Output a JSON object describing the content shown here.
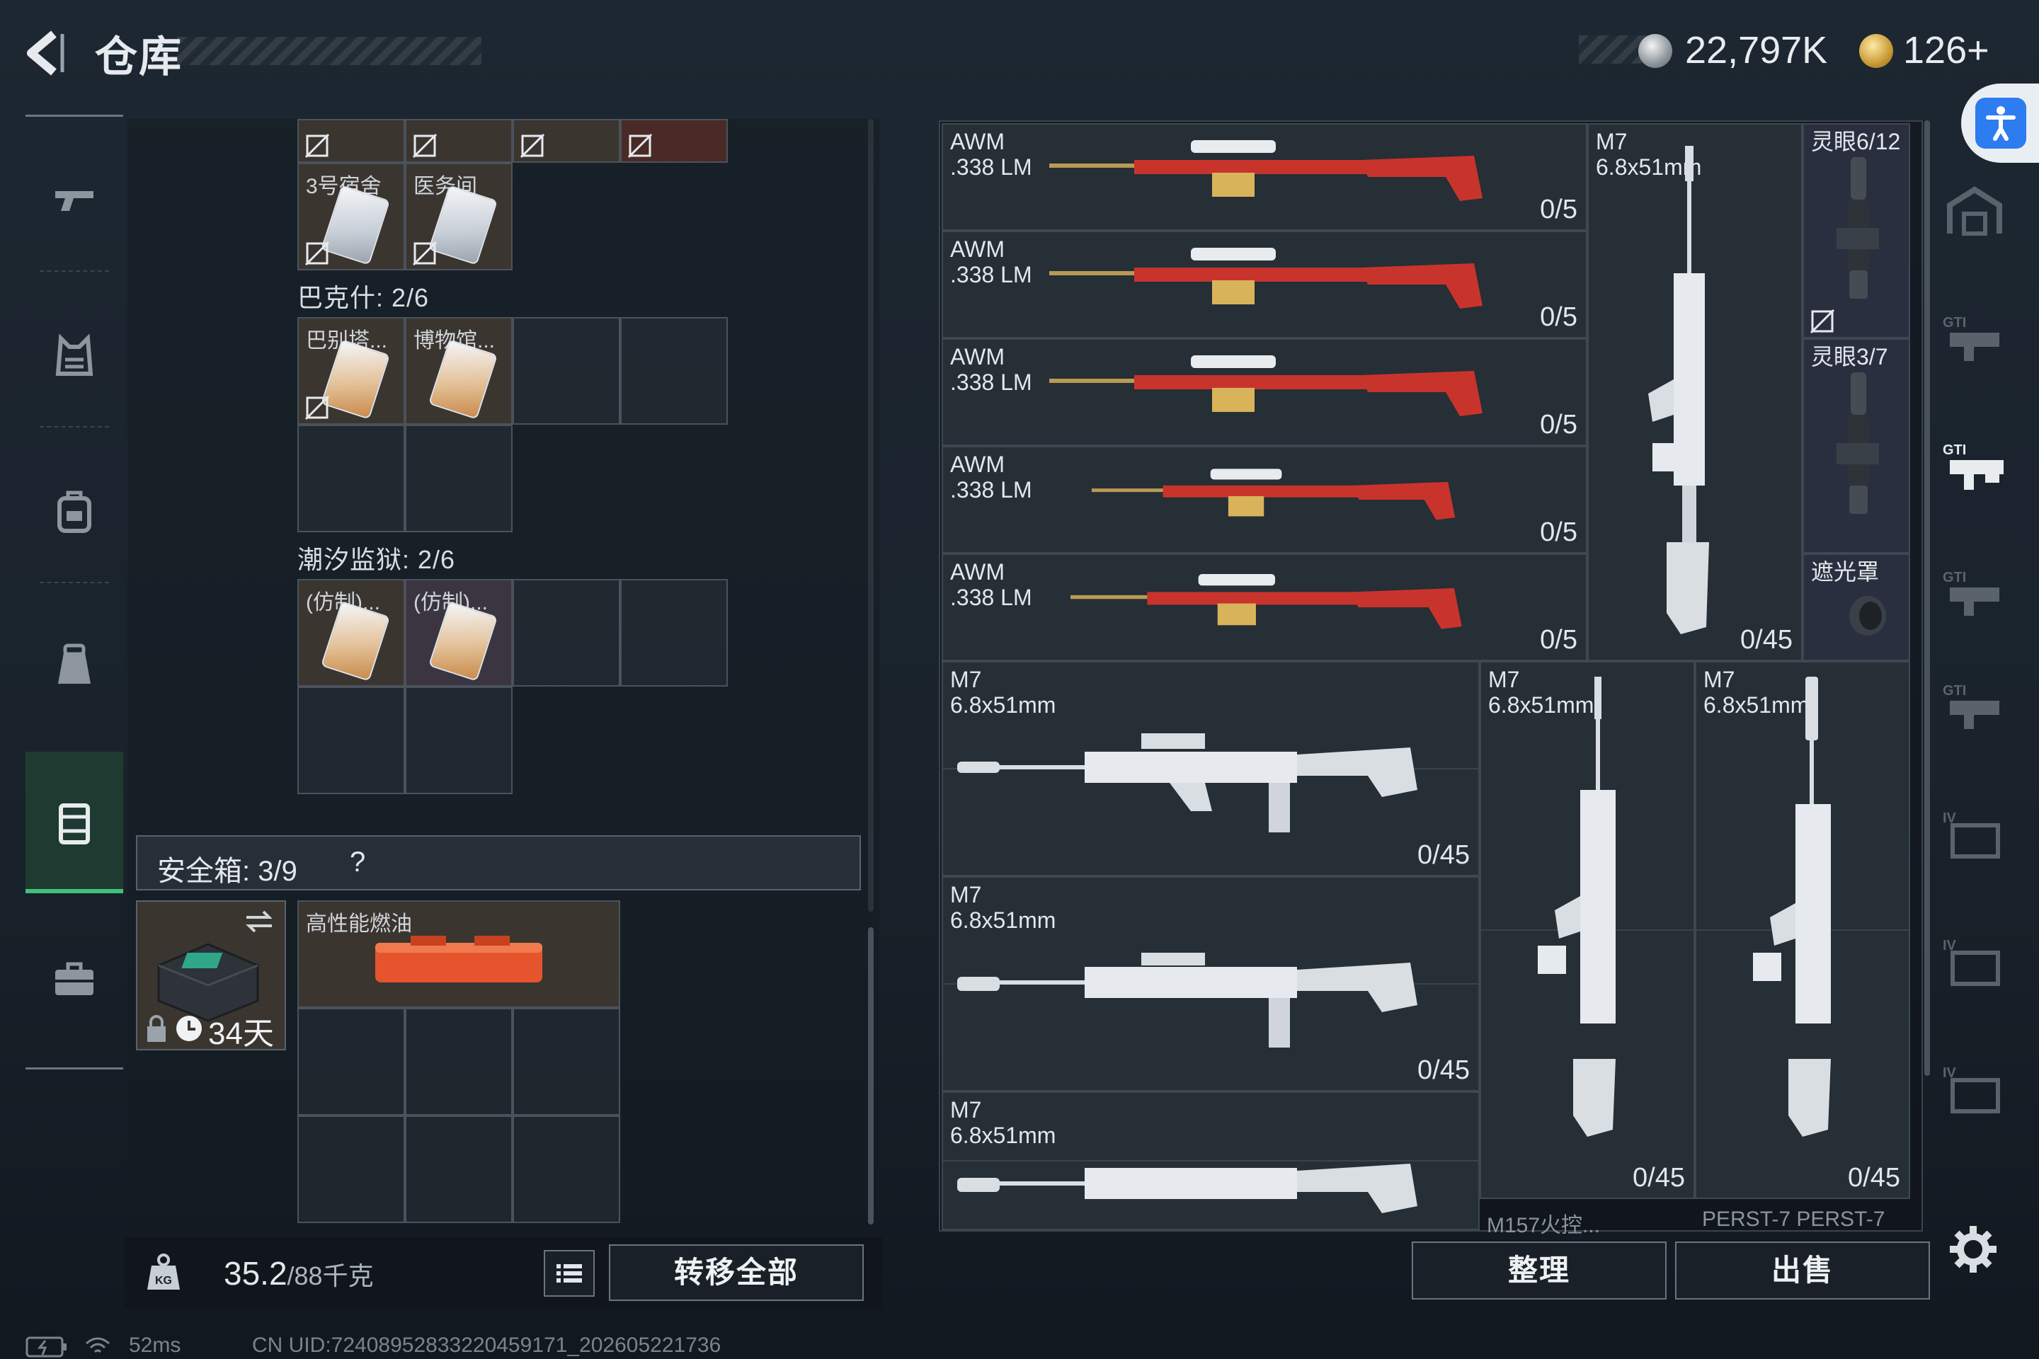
{
  "header": {
    "title": "仓库",
    "currency_silver": "22,797K",
    "currency_gold": "126",
    "gold_plus": "+"
  },
  "storage": {
    "top_row_labels": [
      "3号宿舍",
      "医务间"
    ],
    "section_bakshi": "巴克什: 2/6",
    "bakshi_items": [
      "巴别塔...",
      "博物馆..."
    ],
    "section_tidal": "潮汐监狱: 2/6",
    "tidal_items": [
      "(仿制)...",
      "(仿制)..."
    ],
    "safebox_label": "安全箱: 3/9",
    "safebox_help": "?",
    "safebox_days": "34天",
    "fuel_label": "高性能燃油",
    "weight_current": "35.2",
    "weight_max": "/88千克",
    "transfer_all": "转移全部"
  },
  "weapons": {
    "awm": [
      {
        "name": "AWM\n.338 LM",
        "ammo": "0/5"
      },
      {
        "name": "AWM\n.338 LM",
        "ammo": "0/5"
      },
      {
        "name": "AWM\n.338 LM",
        "ammo": "0/5"
      },
      {
        "name": "AWM\n.338 LM",
        "ammo": "0/5"
      },
      {
        "name": "AWM\n.338 LM",
        "ammo": "0/5"
      }
    ],
    "m7_tall": {
      "name": "M7\n6.8x51mm",
      "ammo": "0/45"
    },
    "attachments": [
      "灵眼6/12",
      "灵眼3/7",
      "遮光罩"
    ],
    "m7_wide": [
      {
        "name": "M7\n6.8x51mm",
        "ammo": "0/45"
      },
      {
        "name": "M7\n6.8x51mm",
        "ammo": "0/45"
      },
      {
        "name": "M7\n6.8x51mm",
        "ammo": ""
      }
    ],
    "m7_vertical": [
      {
        "name": "M7\n6.8x51mm",
        "ammo": "0/45",
        "caption": "M157火控..."
      },
      {
        "name": "M7\n6.8x51mm",
        "ammo": "0/45",
        "caption": "PERST-7 PERST-7"
      }
    ],
    "sort_label": "整理",
    "sell_label": "出售"
  },
  "status_bar": {
    "ping": "52ms",
    "uid": "CN UID:7240895283322045917​1_202605221736"
  },
  "colors": {
    "active_nav": "#3ec27a",
    "awm_red": "#c8342c",
    "accessibility_blue": "#2d7cf0"
  }
}
